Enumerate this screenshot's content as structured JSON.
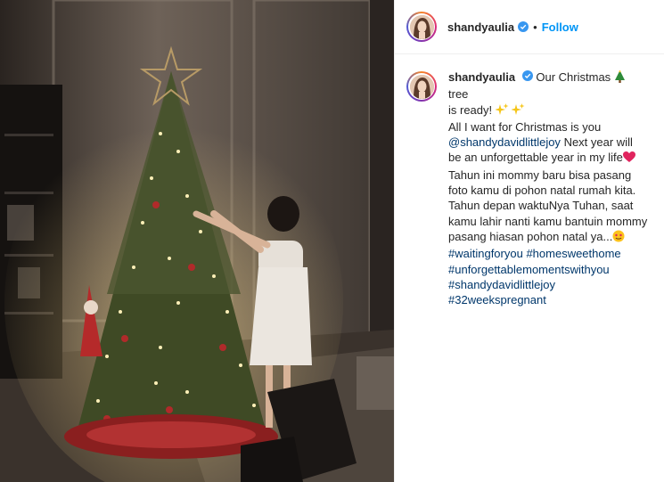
{
  "header": {
    "username": "shandyaulia",
    "separator": "•",
    "follow_label": "Follow"
  },
  "caption": {
    "username": "shandyaulia",
    "line1_text": "Our Christmas",
    "line1_after": "tree",
    "line2": "is ready!",
    "line3": "All I want for Christmas is you",
    "mention": "@shandydavidlittlejoy",
    "line4_after": "Next year will be an unforgettable year in my life",
    "line5": "Tahun ini mommy baru bisa pasang foto kamu di pohon natal rumah kita. Tahun depan waktuNya Tuhan, saat kamu lahir nanti kamu bantuin mommy pasang hiasan pohon natal ya...",
    "hashtags": [
      "#waitingforyou #homesweethome",
      "#unforgettablemomentswithyou",
      "#shandydavidlittlejoy",
      "#32weekspregnant"
    ]
  },
  "icons": {
    "verified": "verified-badge-icon",
    "tree": "christmas-tree-emoji-icon",
    "sparkles": "sparkles-emoji-icon",
    "heart": "red-heart-emoji-icon",
    "smile": "smiling-face-with-hearts-emoji-icon"
  },
  "colors": {
    "follow": "#0095f6",
    "link": "#00376b",
    "text": "#262626"
  }
}
